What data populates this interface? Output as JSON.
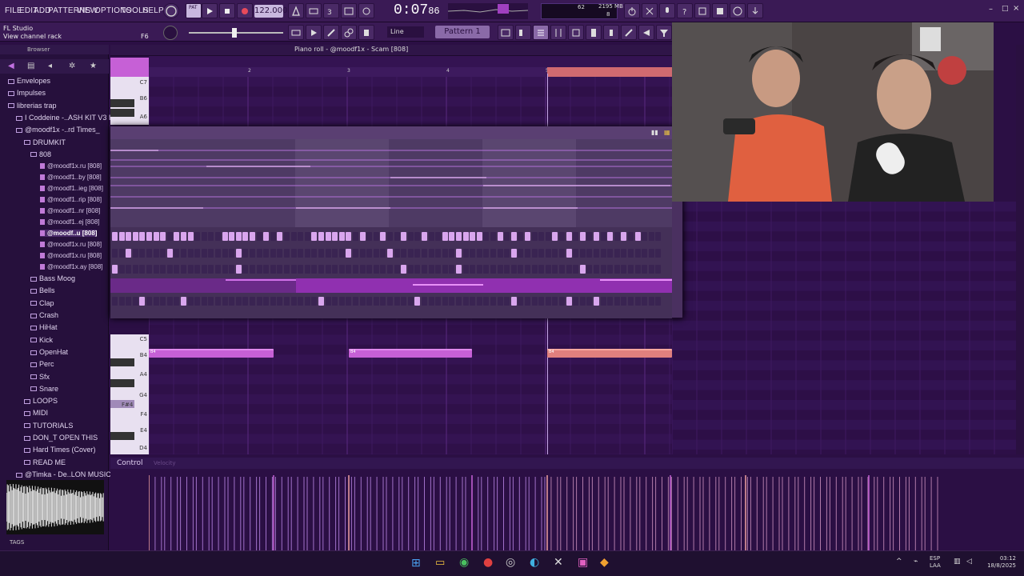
{
  "menu": {
    "items": [
      "FILE",
      "EDIT",
      "ADD",
      "PATTERNS",
      "VIEW",
      "OPTIONS",
      "TOOLS",
      "HELP"
    ]
  },
  "transport": {
    "tempo": "122.000",
    "song_time": "0:07",
    "song_time_ms": "86",
    "mode_label": "PAT"
  },
  "cpu": {
    "memory": "2195 MB",
    "polyphony": "8",
    "cpu_value": "62"
  },
  "hint": {
    "app": "FL Studio",
    "text": "View channel rack",
    "key": "F6"
  },
  "toolbar2": {
    "snap": "Line",
    "pattern": "Pattern 1"
  },
  "browser": {
    "title": "Browser",
    "items": [
      {
        "label": "Envelopes",
        "level": 1
      },
      {
        "label": "Impulses",
        "level": 1
      },
      {
        "label": "librerias trap",
        "level": 1
      },
      {
        "label": "I Coddeine -..ASH KIT V3 I",
        "level": 2
      },
      {
        "label": "@moodf1x -..rd Times_",
        "level": 2
      },
      {
        "label": "DRUMKIT",
        "level": 3
      },
      {
        "label": "808",
        "level": 4
      },
      {
        "label": "@moodf1x.ru [808]",
        "level": 5
      },
      {
        "label": "@moodf1..by [808]",
        "level": 5
      },
      {
        "label": "@moodf1..ieg [808]",
        "level": 5
      },
      {
        "label": "@moodf1..rip [808]",
        "level": 5
      },
      {
        "label": "@moodf1..nr [808]",
        "level": 5
      },
      {
        "label": "@moodf1..ej [808]",
        "level": 5
      },
      {
        "label": "@moodf..u [808]",
        "level": 5,
        "selected": true
      },
      {
        "label": "@moodf1x.ru [808]",
        "level": 5
      },
      {
        "label": "@moodf1x.ru [808]",
        "level": 5
      },
      {
        "label": "@moodf1x.ay [808]",
        "level": 5
      },
      {
        "label": "Bass Moog",
        "level": 4
      },
      {
        "label": "Bells",
        "level": 4
      },
      {
        "label": "Clap",
        "level": 4
      },
      {
        "label": "Crash",
        "level": 4
      },
      {
        "label": "HiHat",
        "level": 4
      },
      {
        "label": "Kick",
        "level": 4
      },
      {
        "label": "OpenHat",
        "level": 4
      },
      {
        "label": "Perc",
        "level": 4
      },
      {
        "label": "Sfx",
        "level": 4
      },
      {
        "label": "Snare",
        "level": 4
      },
      {
        "label": "LOOPS",
        "level": 3
      },
      {
        "label": "MIDI",
        "level": 3
      },
      {
        "label": "TUTORIALS",
        "level": 3
      },
      {
        "label": "DON_T OPEN THIS",
        "level": 3
      },
      {
        "label": "Hard Times (Cover)",
        "level": 3
      },
      {
        "label": "READ ME",
        "level": 3
      },
      {
        "label": "@Timka - De..LON MUSIC_",
        "level": 2
      }
    ],
    "tags_label": "TAGS"
  },
  "piano_roll": {
    "title": "Piano roll - @moodf1x - Scam [808]",
    "bar_numbers": [
      "2",
      "3",
      "4",
      "5",
      "6"
    ],
    "upper_keys": [
      "C7",
      "B6",
      "A6"
    ],
    "lower_keys": [
      "C5",
      "B4",
      "A4",
      "G4",
      "F#4",
      "F4",
      "E4",
      "D4"
    ],
    "note_label": "B4",
    "note_label_upper": "E5"
  },
  "velocity": {
    "label": "Control",
    "sub_label": "Velocity"
  },
  "taskbar": {
    "lang": "ESP",
    "lang2": "LAA",
    "time": "03:12",
    "date": "18/8/2025"
  },
  "colors": {
    "accent": "#c660d6",
    "salmon": "#e0807e",
    "bg": "#2b0f44"
  }
}
